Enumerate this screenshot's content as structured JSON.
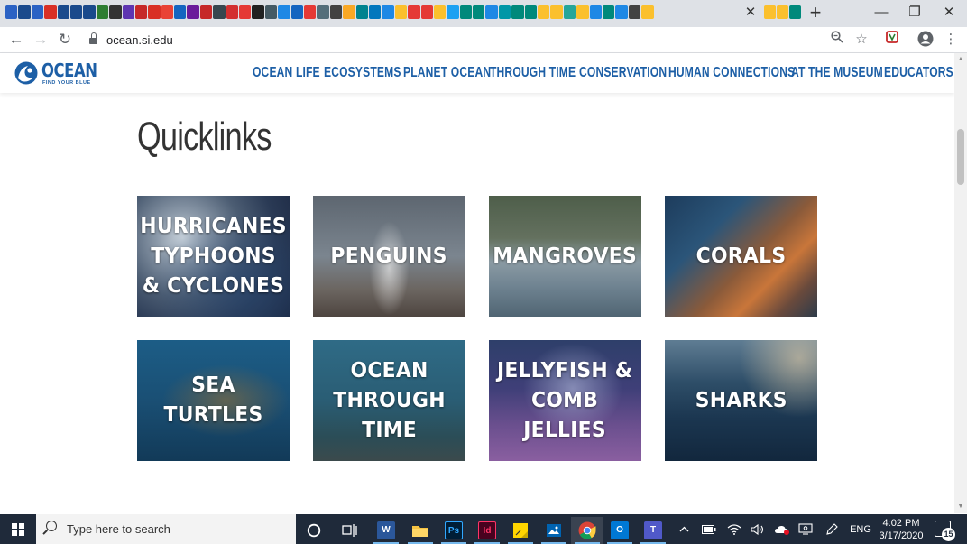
{
  "browser": {
    "url": "ocean.si.edu",
    "tab_close": "✕",
    "new_tab": "+",
    "favicon_colors": [
      "#2b62c4",
      "#1a4a8c",
      "#2b62c4",
      "#d93025",
      "#1a4a8c",
      "#1a4a8c",
      "#1a4a8c",
      "#2e7d32",
      "#333333",
      "#5e35b1",
      "#c62828",
      "#d93025",
      "#e94235",
      "#1565c0",
      "#6a1b9a",
      "#c62828",
      "#37474f",
      "#d32f2f",
      "#e53935",
      "#212121",
      "#455a64",
      "#1e88e5",
      "#1565c0",
      "#e53935",
      "#546e7a",
      "#424242",
      "#f9a825",
      "#00838f",
      "#0277bd",
      "#1e88e5",
      "#fbc02d",
      "#e53935",
      "#e53935",
      "#fbc02d",
      "#1da1f2",
      "#00897b",
      "#00897b",
      "#1e88e5",
      "#0097a7",
      "#00897b",
      "#00897b",
      "#fbc02d",
      "#fbc02d",
      "#26a69a",
      "#fbc02d",
      "#1e88e5",
      "#00897b",
      "#1e88e5",
      "#424242",
      "#fbc02d"
    ],
    "window_minimize": "—",
    "window_restore": "❐",
    "window_close": "✕"
  },
  "site": {
    "logo_word": "OCEAN",
    "logo_tagline": "FIND YOUR BLUE",
    "nav": [
      {
        "label": "OCEAN LIFE"
      },
      {
        "label": "ECOSYSTEMS"
      },
      {
        "label": "PLANET OCEAN"
      },
      {
        "label": "THROUGH TIME"
      },
      {
        "label": "CONSERVATION"
      },
      {
        "label": "HUMAN CONNECTIONS"
      },
      {
        "label": "AT THE MUSEUM"
      },
      {
        "label": "EDUCATORS"
      }
    ]
  },
  "content": {
    "heading": "Quicklinks",
    "tiles": [
      {
        "label": "HURRICANES\nTYPHOONS\n& CYCLONES"
      },
      {
        "label": "PENGUINS"
      },
      {
        "label": "MANGROVES"
      },
      {
        "label": "CORALS"
      },
      {
        "label": "SEA TURTLES"
      },
      {
        "label": "OCEAN\nTHROUGH\nTIME"
      },
      {
        "label": "JELLYFISH &\nCOMB\nJELLIES"
      },
      {
        "label": "SHARKS"
      }
    ]
  },
  "taskbar": {
    "search_placeholder": "Type here to search",
    "time": "4:02 PM",
    "date": "3/17/2020",
    "language": "ENG",
    "notifications": "15",
    "apps": [
      {
        "icon": "cortana-icon"
      },
      {
        "icon": "task-view-icon"
      },
      {
        "icon": "word-icon",
        "glyph": "W",
        "color": "#2b579a"
      },
      {
        "icon": "file-explorer-icon",
        "color": "#f6c342"
      },
      {
        "icon": "photoshop-icon",
        "glyph": "Ps",
        "color": "#001e36"
      },
      {
        "icon": "indesign-icon",
        "glyph": "Id",
        "color": "#49021f"
      },
      {
        "icon": "sticky-notes-icon",
        "color": "#ffd500"
      },
      {
        "icon": "photos-icon",
        "color": "#0063b1"
      },
      {
        "icon": "chrome-icon"
      },
      {
        "icon": "outlook-icon",
        "glyph": "O",
        "color": "#0078d4"
      },
      {
        "icon": "teams-icon",
        "glyph": "T",
        "color": "#5059c9"
      }
    ]
  },
  "colors": {
    "brand_blue": "#1d5fa6",
    "heading": "#333333",
    "taskbar": "#1f2a3a"
  }
}
